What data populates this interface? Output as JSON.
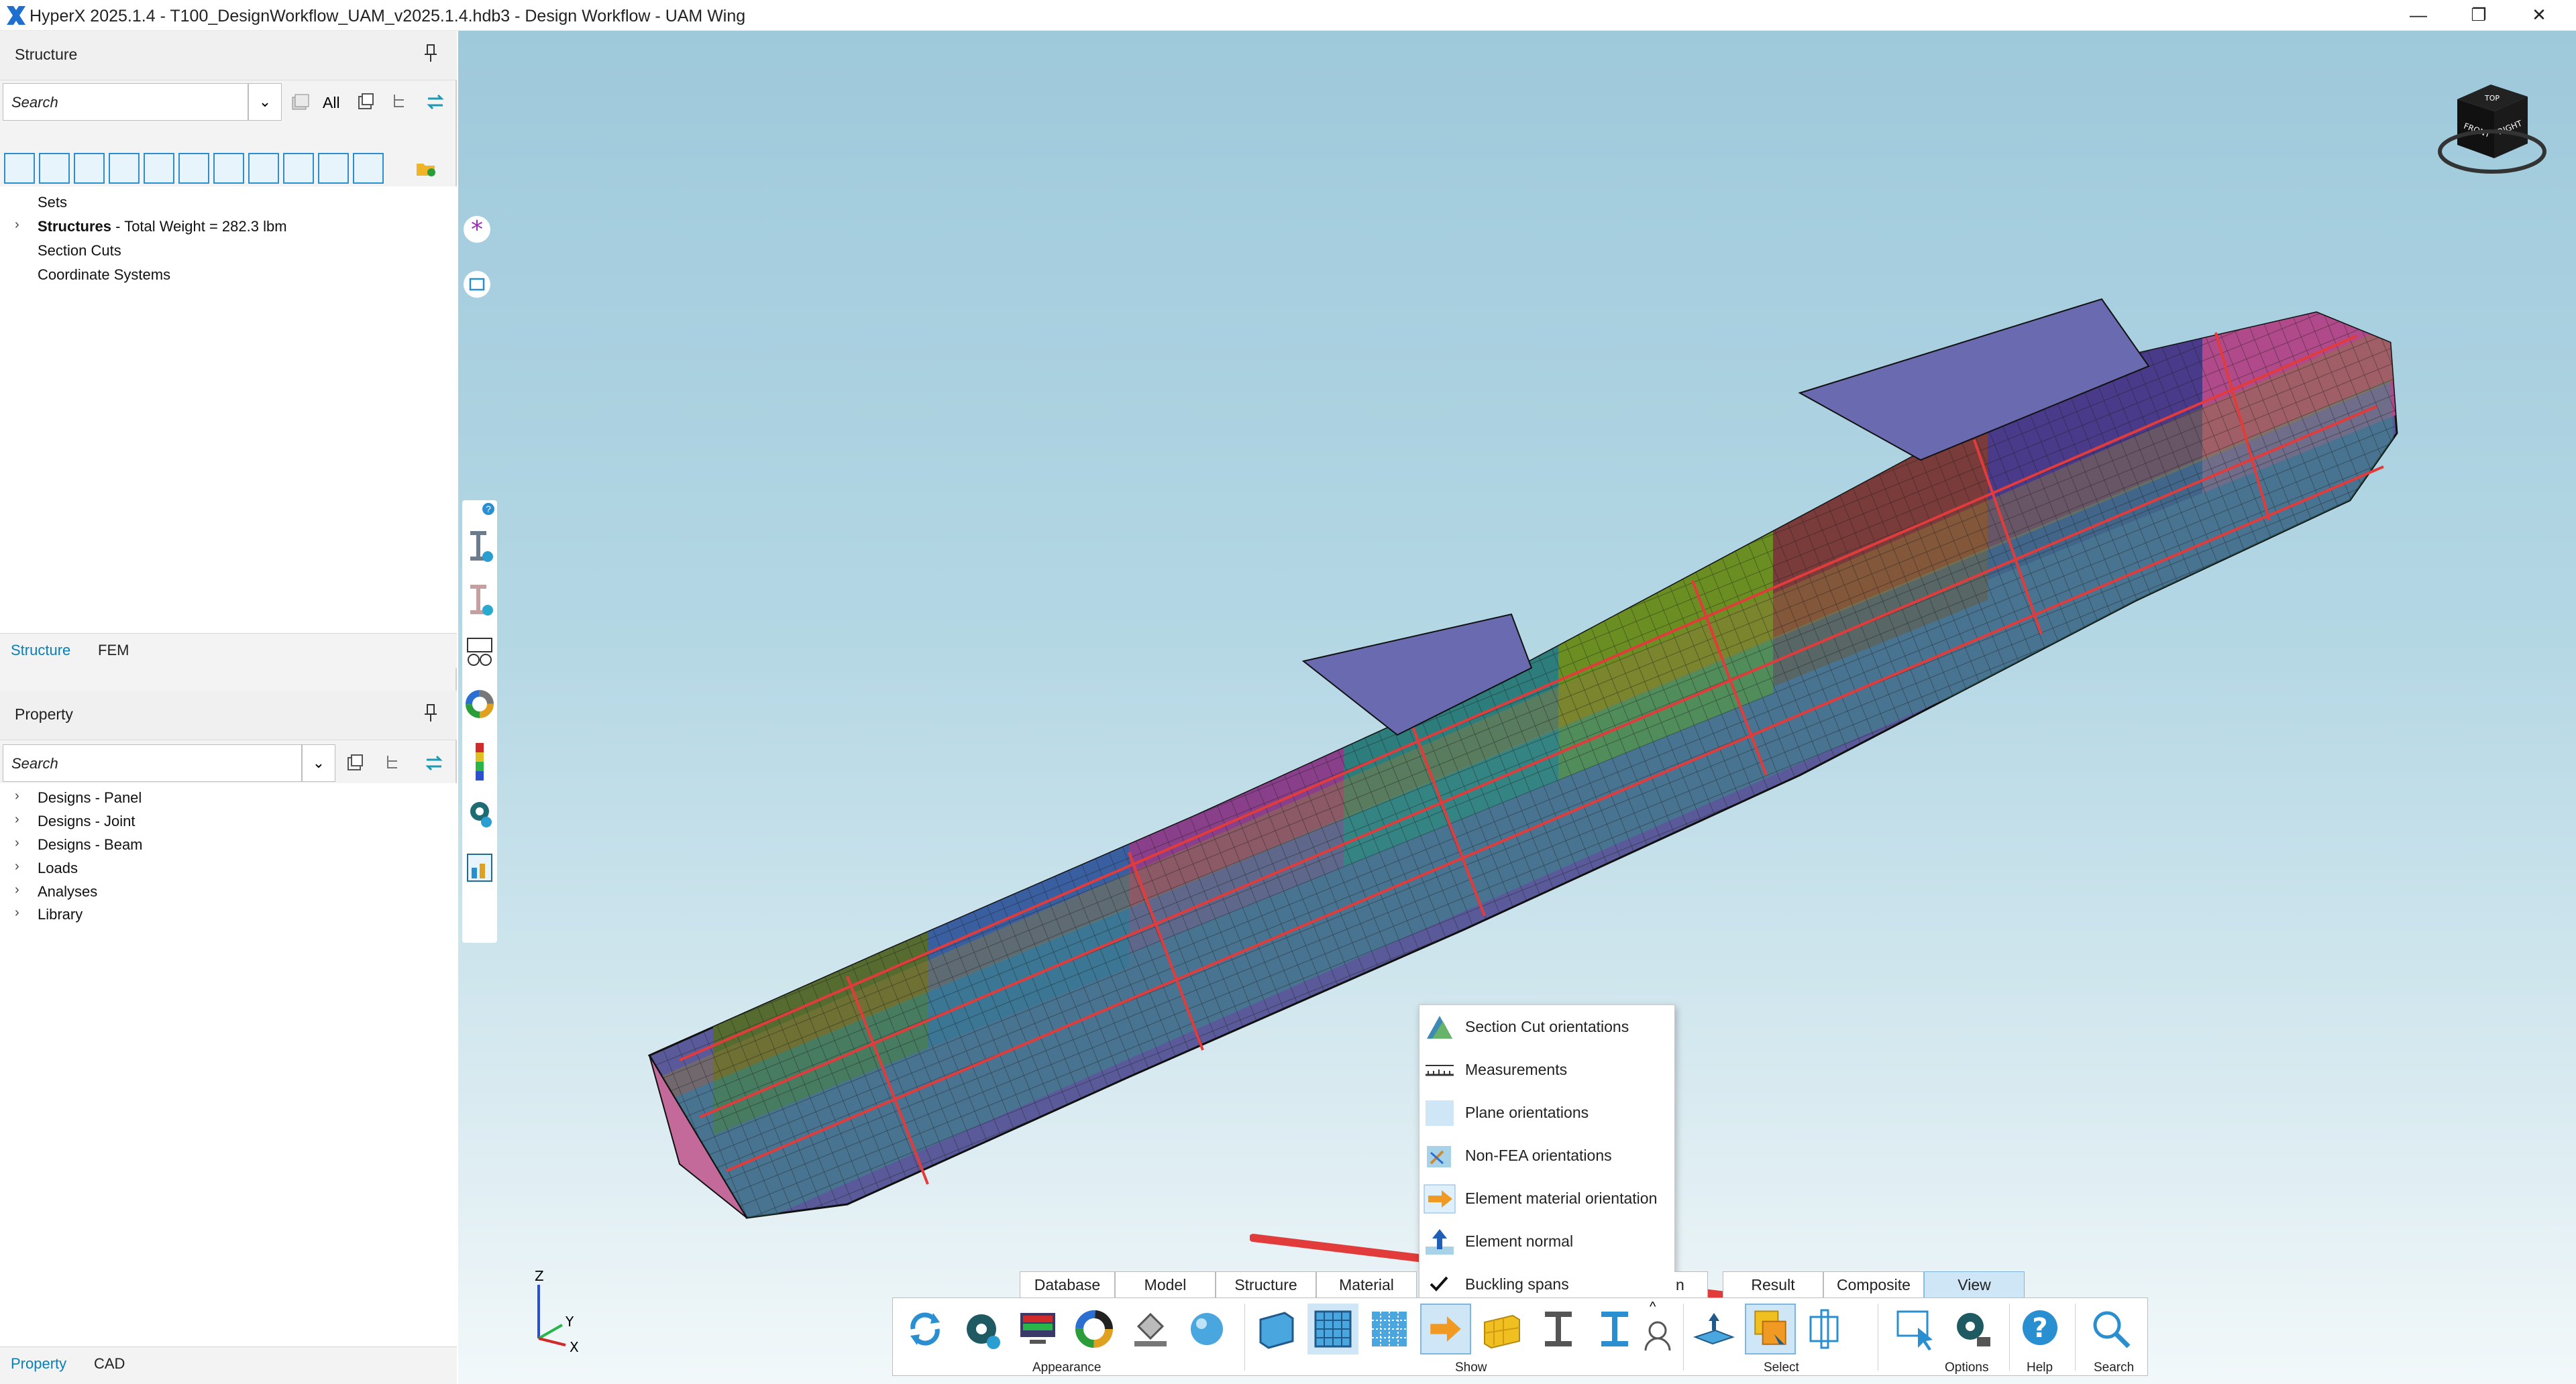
{
  "window": {
    "title": "HyperX 2025.1.4 - T100_DesignWorkflow_UAM_v2025.1.4.hdb3 - Design Workflow - UAM Wing",
    "minimize": "—",
    "restore": "❐",
    "close": "✕",
    "logo_color": "#1f6fd0"
  },
  "structure_panel": {
    "title": "Structure",
    "search_placeholder": "Search",
    "all_label": "All",
    "tree": [
      {
        "label": "Sets",
        "expandable": false
      },
      {
        "label": "Structures",
        "detail": " - Total Weight = 282.3 lbm",
        "expandable": true
      },
      {
        "label": "Section Cuts",
        "expandable": false
      },
      {
        "label": "Coordinate Systems",
        "expandable": false
      }
    ],
    "tabs": [
      {
        "label": "Structure",
        "active": true
      },
      {
        "label": "FEM",
        "active": false
      }
    ]
  },
  "property_panel": {
    "title": "Property",
    "search_placeholder": "Search",
    "tree": [
      {
        "label": "Designs - Panel"
      },
      {
        "label": "Designs - Joint"
      },
      {
        "label": "Designs - Beam"
      },
      {
        "label": "Loads"
      },
      {
        "label": "Analyses"
      },
      {
        "label": "Library"
      }
    ],
    "tabs": [
      {
        "label": "Property",
        "active": true
      },
      {
        "label": "CAD",
        "active": false
      }
    ]
  },
  "viewcube": {
    "front": "FRONT",
    "right": "RIGHT",
    "top": "TOP"
  },
  "triad": {
    "z": "Z",
    "y": "Y",
    "x": "X"
  },
  "help_badge": "?",
  "context_menu": {
    "items": [
      {
        "label": "Section Cut orientations",
        "icon": "section-cut-icon",
        "checked": false
      },
      {
        "label": "Measurements",
        "icon": "ruler-icon",
        "checked": false
      },
      {
        "label": "Plane orientations",
        "icon": "plane-icon",
        "checked": false
      },
      {
        "label": "Non-FEA orientations",
        "icon": "non-fea-icon",
        "checked": false
      },
      {
        "label": "Element material orientation",
        "icon": "orange-arrow-icon",
        "checked": false
      },
      {
        "label": "Element normal",
        "icon": "normal-arrow-icon",
        "checked": false
      },
      {
        "label": "Buckling spans",
        "icon": "check-icon",
        "checked": true
      }
    ]
  },
  "ribbon": {
    "tabs": [
      {
        "label": "Database",
        "active": false
      },
      {
        "label": "Model",
        "active": false
      },
      {
        "label": "Structure",
        "active": false
      },
      {
        "label": "Material",
        "active": false
      },
      {
        "label": "n",
        "active": false
      },
      {
        "label": "Result",
        "active": false
      },
      {
        "label": "Composite",
        "active": false
      },
      {
        "label": "View",
        "active": true
      }
    ],
    "groups": {
      "appearance": "Appearance",
      "show": "Show",
      "select": "Select",
      "options": "Options",
      "help": "Help",
      "search": "Search"
    },
    "up_chevron": "^"
  },
  "colors": {
    "accent_blue": "#0a7fb5",
    "annotation_red": "#e23b3b",
    "viewport_top": "#9ec9db"
  }
}
